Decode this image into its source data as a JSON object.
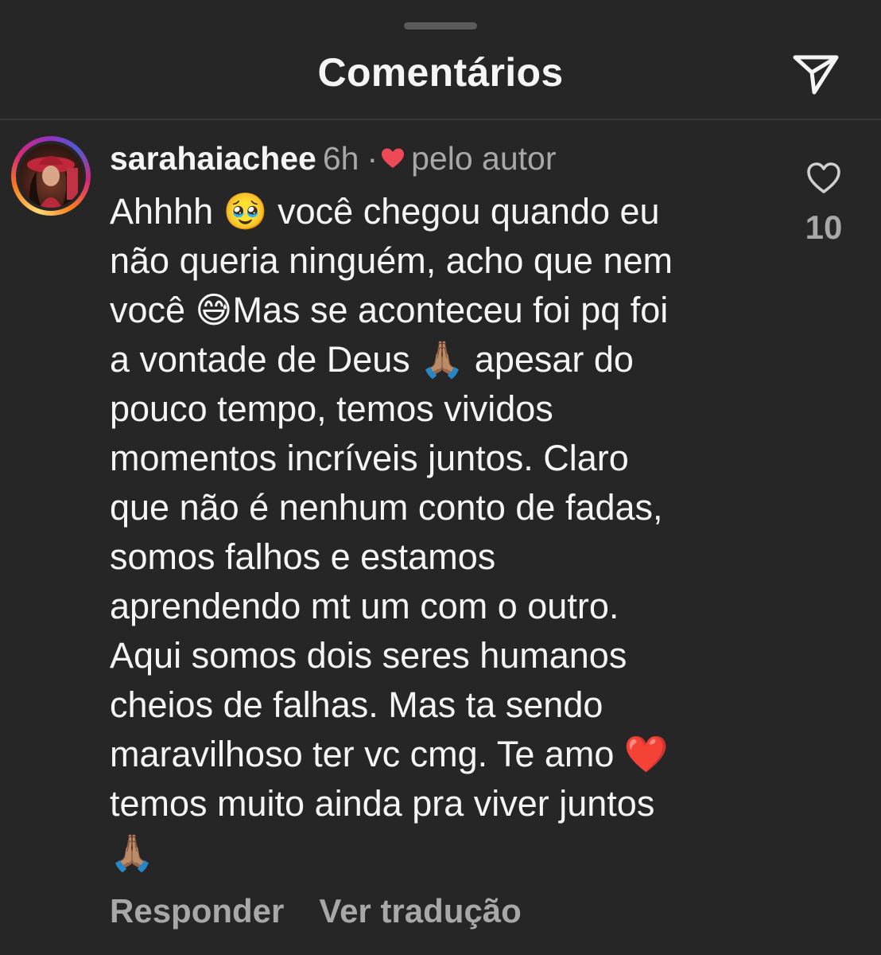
{
  "sheet": {
    "title": "Comentários"
  },
  "icons": {
    "share": "paper-plane-icon",
    "like": "heart-outline-icon",
    "author_like": "heart-filled-icon"
  },
  "colors": {
    "background": "#262626",
    "text": "#f5f5f5",
    "secondary_text": "#a8a8a8",
    "author_heart": "#ed4956"
  },
  "comment": {
    "username": "sarahaiachee",
    "time": "6h",
    "separator": "·",
    "liked_by_author_label": "pelo autor",
    "text": "Ahhhh 🥹 você chegou quando eu\nnão queria ninguém, acho que nem\nvocê 😅Mas se aconteceu foi pq foi\na vontade de Deus 🙏🏽 apesar do\npouco tempo, temos vividos\nmomentos incríveis juntos. Claro\nque não é nenhum conto de fadas,\nsomos falhos e estamos\naprendendo mt um com o outro.\nAqui somos dois seres humanos\ncheios de falhas. Mas ta sendo\nmaravilhoso ter vc cmg. Te amo ❤️\ntemos muito ainda pra viver juntos\n🙏🏽",
    "like_count": "10",
    "reply_label": "Responder",
    "translate_label": "Ver tradução"
  }
}
